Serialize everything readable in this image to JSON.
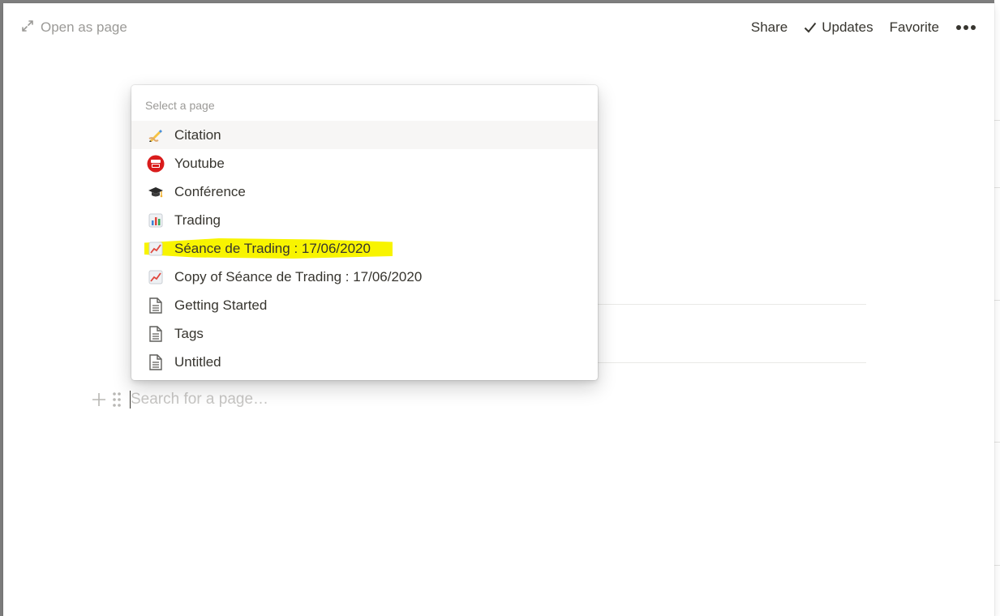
{
  "topbar": {
    "open_as_page": "Open as page",
    "share": "Share",
    "updates": "Updates",
    "favorite": "Favorite"
  },
  "menu": {
    "header": "Select a page",
    "items": [
      {
        "label": "Citation",
        "icon": "writing-hand-icon"
      },
      {
        "label": "Youtube",
        "icon": "youtube-icon"
      },
      {
        "label": "Conférence",
        "icon": "graduation-cap-icon"
      },
      {
        "label": "Trading",
        "icon": "bar-chart-icon"
      },
      {
        "label": "Séance de Trading : 17/06/2020",
        "icon": "trending-up-chart-icon",
        "highlighted": true
      },
      {
        "label": "Copy of Séance de Trading : 17/06/2020",
        "icon": "trending-up-chart-icon"
      },
      {
        "label": "Getting Started",
        "icon": "page-icon"
      },
      {
        "label": "Tags",
        "icon": "page-icon"
      },
      {
        "label": "Untitled",
        "icon": "page-icon"
      }
    ]
  },
  "search": {
    "placeholder": "Search for a page…"
  },
  "colors": {
    "highlight": "#f8f400",
    "text": "#37352f",
    "muted": "#9b9a97"
  }
}
